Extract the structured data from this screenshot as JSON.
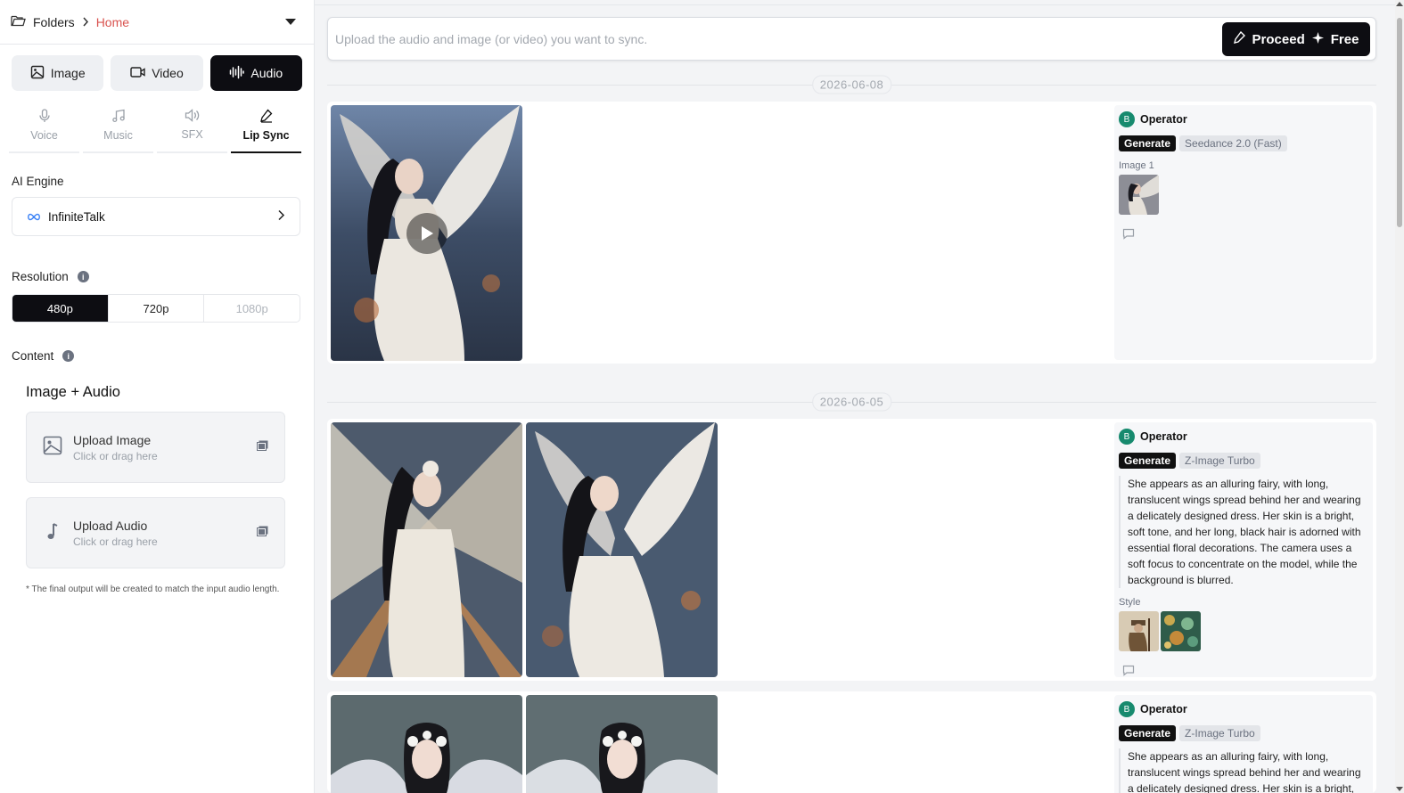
{
  "breadcrumb": {
    "root": "Folders",
    "current": "Home"
  },
  "modes": [
    {
      "label": "Image",
      "icon": "image-icon"
    },
    {
      "label": "Video",
      "icon": "video-icon"
    },
    {
      "label": "Audio",
      "icon": "audio-wave-icon",
      "active": true
    }
  ],
  "audio_tabs": [
    {
      "label": "Voice",
      "icon": "microphone-icon"
    },
    {
      "label": "Music",
      "icon": "music-note-icon"
    },
    {
      "label": "SFX",
      "icon": "speaker-icon"
    },
    {
      "label": "Lip Sync",
      "icon": "pen-icon",
      "active": true
    }
  ],
  "engine": {
    "label": "AI Engine",
    "value": "InfiniteTalk"
  },
  "resolution": {
    "label": "Resolution",
    "options": [
      "480p",
      "720p",
      "1080p"
    ],
    "selected": "480p"
  },
  "content": {
    "label": "Content",
    "title": "Image + Audio",
    "upload_image": {
      "title": "Upload Image",
      "hint": "Click or drag here"
    },
    "upload_audio": {
      "title": "Upload Audio",
      "hint": "Click or drag here"
    },
    "note": "* The final output will be created to match the input audio length."
  },
  "prompt_bar": {
    "placeholder": "Upload the audio and image (or video) you want to sync.",
    "button": "Proceed",
    "badge": "Free"
  },
  "feed": [
    {
      "date": "2026-06-08",
      "operator": "Operator",
      "avatar": "B",
      "action": "Generate",
      "model": "Seedance 2.0 (Fast)",
      "media_label": "Image 1"
    },
    {
      "date": "2026-06-05",
      "operator": "Operator",
      "avatar": "B",
      "action": "Generate",
      "model": "Z-Image Turbo",
      "prompt": "She appears as an alluring fairy, with long, translucent wings spread behind her and wearing a delicately designed dress. Her skin is a bright, soft tone, and her long, black hair is adorned with essential floral decorations. The camera uses a soft focus to concentrate on the model, while the background is blurred.",
      "style_label": "Style"
    },
    {
      "operator": "Operator",
      "avatar": "B",
      "action": "Generate",
      "model": "Z-Image Turbo",
      "prompt": "She appears as an alluring fairy, with long, translucent wings spread behind her and wearing a delicately designed dress. Her skin is a bright, soft"
    }
  ]
}
